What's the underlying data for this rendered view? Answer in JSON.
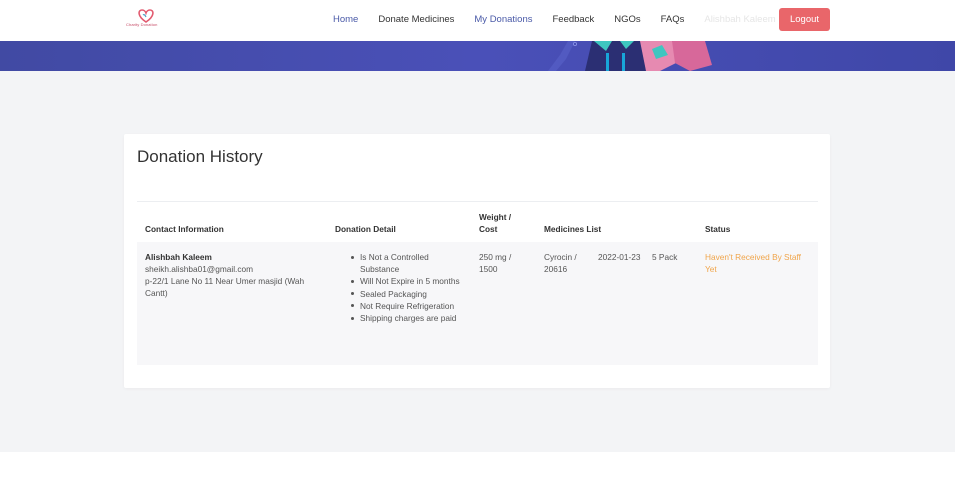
{
  "brand": {
    "logo_text": "Charity Donation",
    "logo_color": "#c64a66"
  },
  "nav": {
    "items": [
      "Home",
      "Donate Medicines",
      "My Donations",
      "Feedback",
      "NGOs",
      "FAQs"
    ],
    "user_name": "Alishbah Kaleem",
    "logout_label": "Logout"
  },
  "colors": {
    "accent": "#4a5aa8",
    "logout": "#e9666a",
    "banner": "#414aa3",
    "status": "#f0a54b"
  },
  "page": {
    "title": "Donation History"
  },
  "table": {
    "headers": {
      "contact": "Contact Information",
      "detail": "Donation Detail",
      "weight_l1": "Weight /",
      "weight_l2": "Cost",
      "medicines": "Medicines List",
      "status": "Status"
    },
    "rows": [
      {
        "name": "Alishbah Kaleem",
        "email": "sheikh.alishba01@gmail.com",
        "address": "p-22/1 Lane No 11 Near Umer masjid (Wah Cantt)",
        "details": [
          "Is Not a Controlled Substance",
          "Will Not Expire in 5 months",
          "Sealed Packaging",
          "Not Require Refrigeration",
          "Shipping charges are paid"
        ],
        "weight_cost": "250 mg / 1500",
        "medicine_name": "Cyrocin / 20616",
        "medicine_date": "2022-01-23",
        "medicine_qty": "5 Pack",
        "status": "Haven't Received By Staff Yet"
      }
    ]
  }
}
